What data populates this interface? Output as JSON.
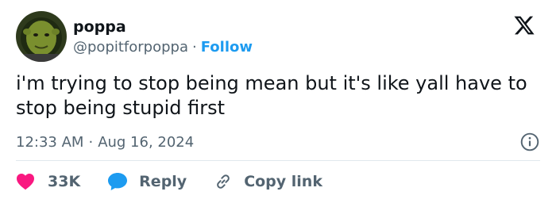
{
  "author": {
    "display_name": "poppa",
    "handle": "@popitforpoppa",
    "separator": "·",
    "follow_label": "Follow"
  },
  "tweet": {
    "text": "i'm trying to stop being mean but it's like yall have to stop being stupid first",
    "time": "12:33 AM",
    "separator": "·",
    "date": "Aug 16, 2024"
  },
  "actions": {
    "likes_count": "33K",
    "reply_label": "Reply",
    "copy_link_label": "Copy link"
  },
  "colors": {
    "accent": "#1d9bf0",
    "like": "#f91880",
    "text_primary": "#0f1419",
    "text_secondary": "#536471"
  },
  "icons": {
    "brand": "x-logo-icon",
    "info": "info-icon",
    "like": "heart-icon",
    "reply": "speech-bubble-icon",
    "copy_link": "link-icon"
  }
}
